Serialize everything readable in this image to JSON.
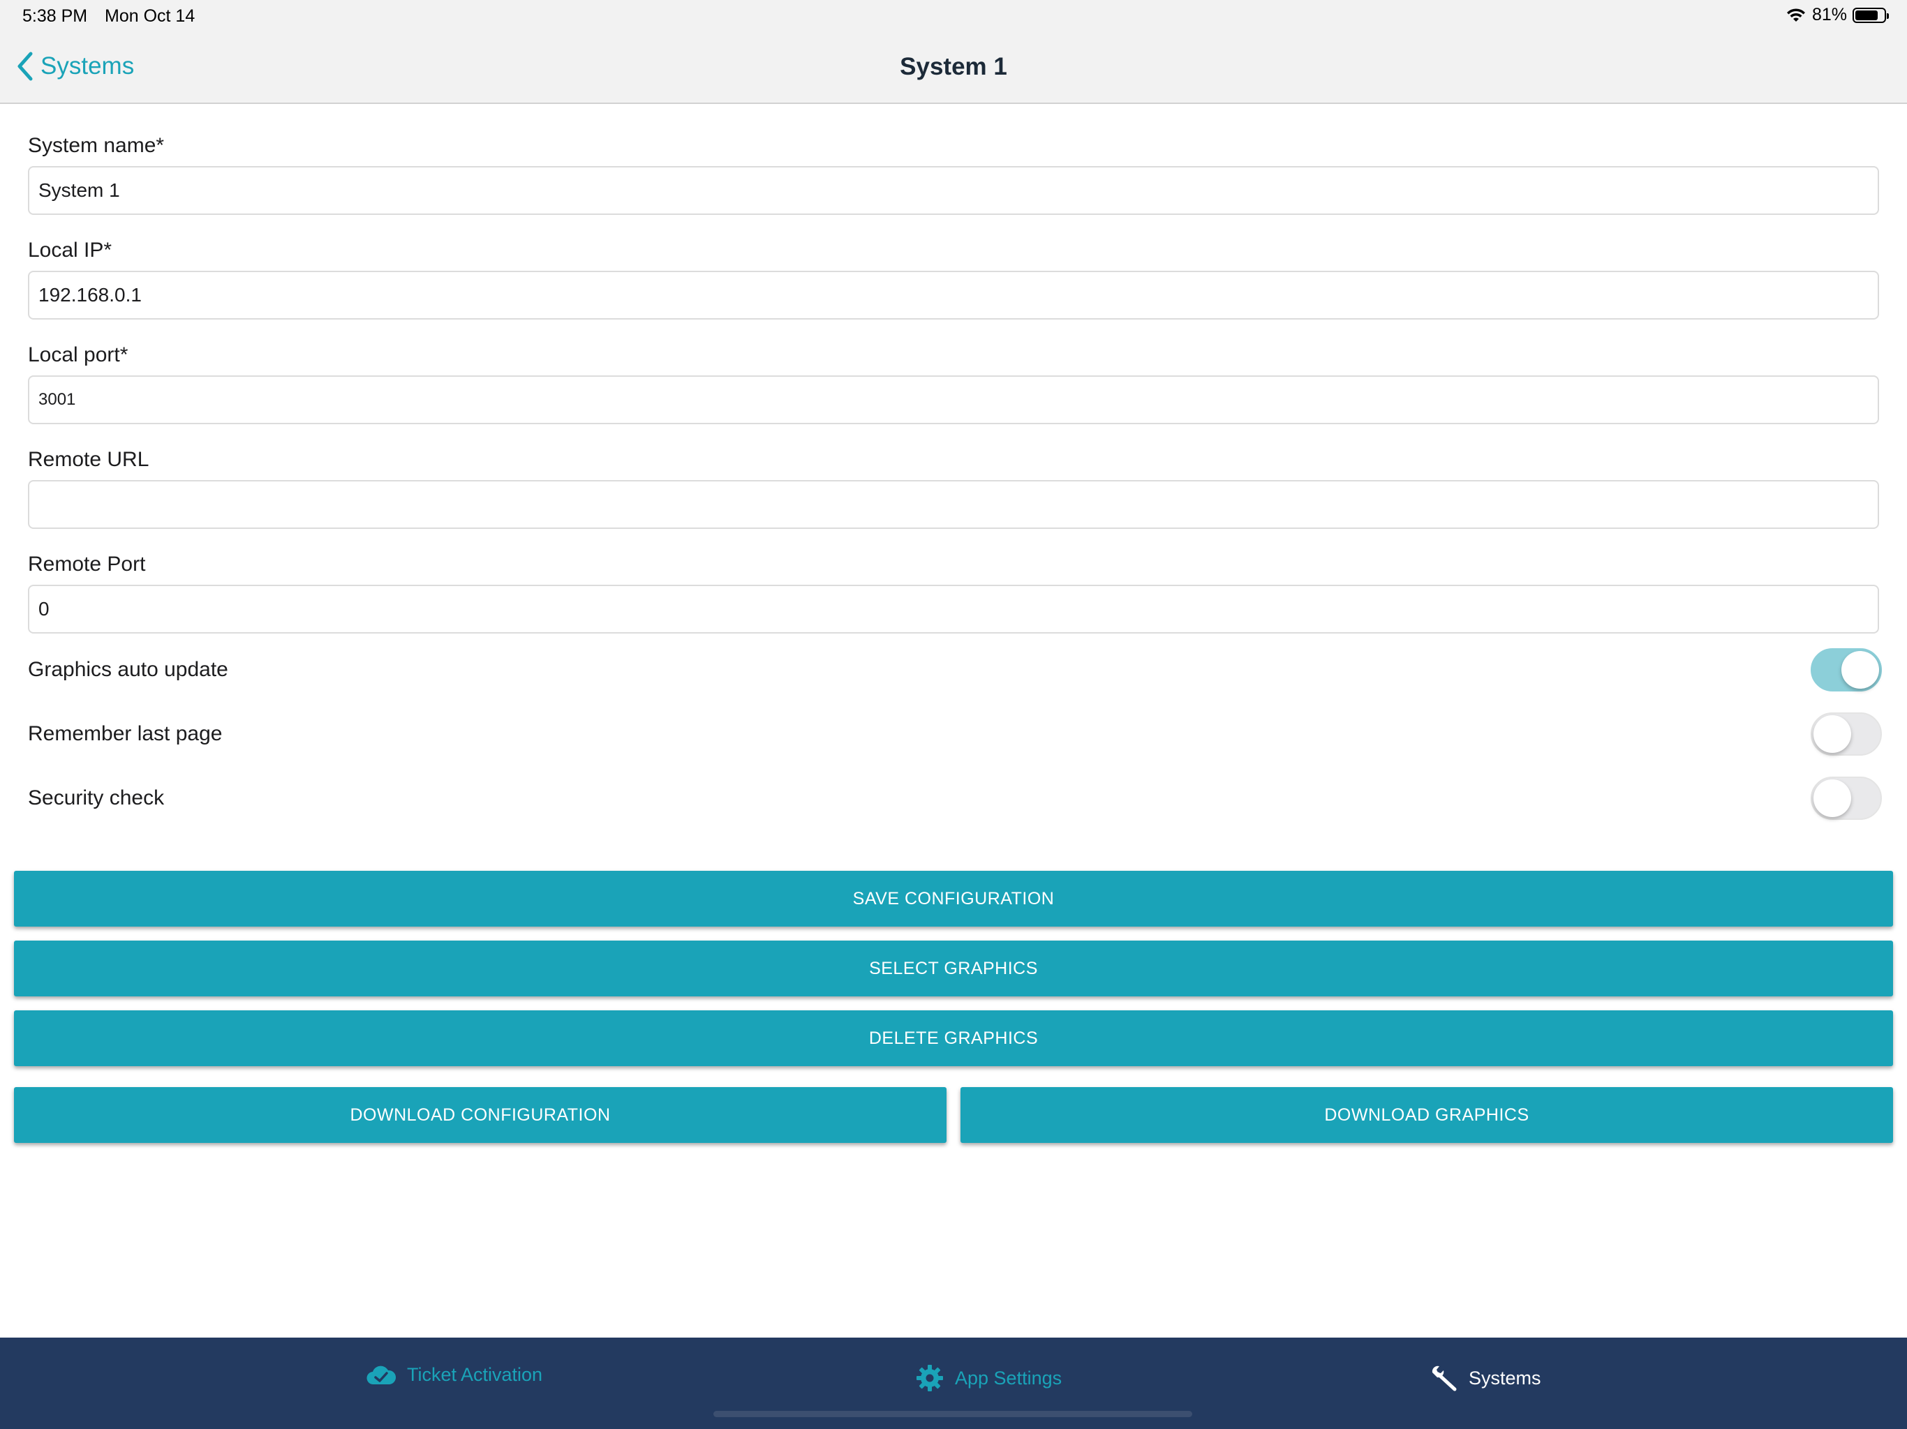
{
  "status_bar": {
    "time": "5:38 PM",
    "date": "Mon Oct 14",
    "battery_percent_label": "81%",
    "battery_level": 0.81,
    "wifi_icon": "wifi-icon"
  },
  "nav": {
    "back_label": "Systems",
    "title": "System 1"
  },
  "form": {
    "system_name": {
      "label": "System name*",
      "value": "System 1"
    },
    "local_ip": {
      "label": "Local IP*",
      "value": "192.168.0.1"
    },
    "local_port": {
      "label": "Local port*",
      "value": "3001"
    },
    "remote_url": {
      "label": "Remote URL",
      "value": ""
    },
    "remote_port": {
      "label": "Remote Port",
      "value": "0"
    }
  },
  "toggles": {
    "graphics_auto_update": {
      "label": "Graphics auto update",
      "on": true
    },
    "remember_last_page": {
      "label": "Remember last page",
      "on": false
    },
    "security_check": {
      "label": "Security check",
      "on": false
    }
  },
  "buttons": {
    "save": "SAVE CONFIGURATION",
    "select_graphics": "SELECT GRAPHICS",
    "delete_graphics": "DELETE GRAPHICS",
    "download_configuration": "DOWNLOAD CONFIGURATION",
    "download_graphics": "DOWNLOAD GRAPHICS"
  },
  "tab_bar": {
    "ticket_activation": {
      "label": "Ticket Activation",
      "icon": "cloud-check-icon"
    },
    "app_settings": {
      "label": "App Settings",
      "icon": "gear-icon"
    },
    "systems": {
      "label": "Systems",
      "icon": "wrench-icon",
      "selected": true
    }
  },
  "colors": {
    "accent": "#1aa3b8",
    "toggle_on": "#8ccfd9",
    "tab_bar_bg": "#233a60",
    "nav_bg": "#f2f2f2"
  }
}
